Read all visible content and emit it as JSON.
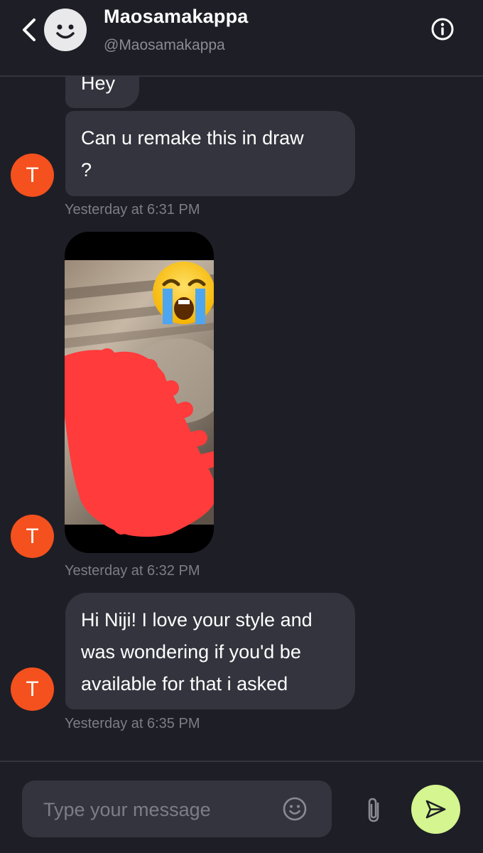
{
  "header": {
    "name": "Maosamakappa",
    "handle": "@Maosamakappa",
    "back_icon": "chevron-left-icon",
    "info_icon": "info-icon"
  },
  "messages": [
    {
      "id": "m0",
      "type": "text",
      "text": "Hey"
    },
    {
      "id": "m1",
      "type": "text",
      "lines": [
        "Can u remake this in draw",
        "?"
      ],
      "avatar_initial": "T",
      "timestamp": "Yesterday at 6:31 PM"
    },
    {
      "id": "m2",
      "type": "image",
      "image_icon": "photo-with-emoji-and-red-scribble",
      "avatar_initial": "T",
      "timestamp": "Yesterday at 6:32 PM"
    },
    {
      "id": "m3",
      "type": "text",
      "lines": [
        "Hi Niji! I love your style and",
        "was wondering if you'd be",
        "available for that i asked"
      ],
      "avatar_initial": "T",
      "timestamp": "Yesterday at 6:35 PM"
    }
  ],
  "composer": {
    "placeholder": "Type your message",
    "value": "",
    "emoji_icon": "smiley-icon",
    "attach_icon": "paperclip-icon",
    "send_icon": "send-icon"
  },
  "colors": {
    "background": "#1e1e26",
    "bubble": "#34343e",
    "avatar": "#f4511e",
    "send_button": "#d4f58f",
    "muted_text": "#7d7d86"
  }
}
